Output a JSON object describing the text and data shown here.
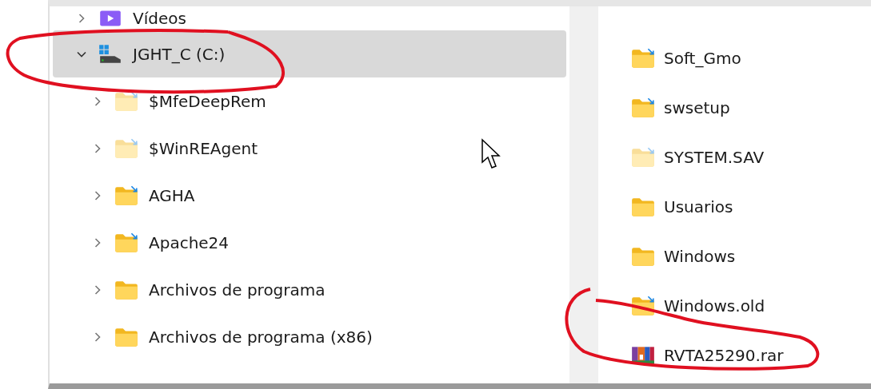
{
  "tree": [
    {
      "label": "Vídeos",
      "kind": "videos",
      "expanded": false,
      "selected": false
    },
    {
      "label": "JGHT_C (C:)",
      "kind": "drive",
      "expanded": true,
      "selected": true,
      "children": [
        {
          "label": "$MfeDeepRem",
          "kind": "folder",
          "expanded": false,
          "selected": false,
          "hidden": true,
          "overlay": true
        },
        {
          "label": "$WinREAgent",
          "kind": "folder",
          "expanded": false,
          "selected": false,
          "hidden": true,
          "overlay": true
        },
        {
          "label": "AGHA",
          "kind": "folder",
          "expanded": false,
          "selected": false,
          "hidden": false,
          "overlay": true
        },
        {
          "label": "Apache24",
          "kind": "folder",
          "expanded": false,
          "selected": false,
          "hidden": false,
          "overlay": true
        },
        {
          "label": "Archivos de programa",
          "kind": "folder",
          "expanded": false,
          "selected": false,
          "hidden": false,
          "overlay": false
        },
        {
          "label": "Archivos de programa (x86)",
          "kind": "folder",
          "expanded": false,
          "selected": false,
          "hidden": false,
          "overlay": false
        }
      ]
    }
  ],
  "files": [
    {
      "name": "Soft_Gmo",
      "kind": "folder",
      "hidden": false,
      "overlay": true
    },
    {
      "name": "swsetup",
      "kind": "folder",
      "hidden": false,
      "overlay": true
    },
    {
      "name": "SYSTEM.SAV",
      "kind": "folder",
      "hidden": true,
      "overlay": true
    },
    {
      "name": "Usuarios",
      "kind": "folder",
      "hidden": false,
      "overlay": false
    },
    {
      "name": "Windows",
      "kind": "folder",
      "hidden": false,
      "overlay": false
    },
    {
      "name": "Windows.old",
      "kind": "folder",
      "hidden": false,
      "overlay": true
    },
    {
      "name": "RVTA25290.rar",
      "kind": "archive"
    }
  ]
}
